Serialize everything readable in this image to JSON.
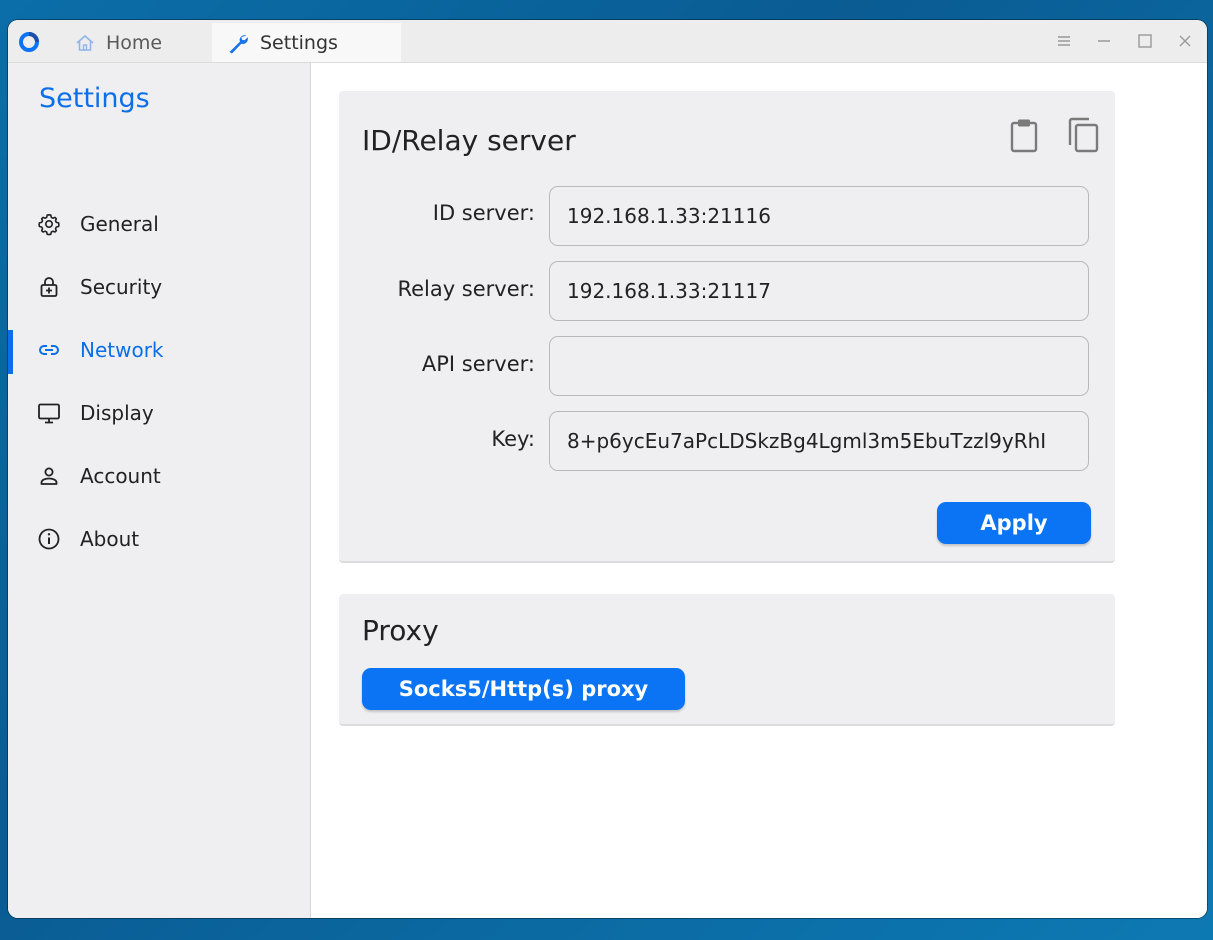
{
  "titlebar": {
    "tabs": [
      {
        "label": "Home",
        "icon": "home-icon"
      },
      {
        "label": "Settings",
        "icon": "wrench-icon"
      }
    ],
    "controls": [
      "menu-icon",
      "minimize-icon",
      "maximize-icon",
      "close-icon"
    ]
  },
  "sidebar": {
    "title": "Settings",
    "items": [
      {
        "label": "General",
        "icon": "gear-icon"
      },
      {
        "label": "Security",
        "icon": "lock-icon"
      },
      {
        "label": "Network",
        "icon": "link-icon",
        "active": true
      },
      {
        "label": "Display",
        "icon": "monitor-icon"
      },
      {
        "label": "Account",
        "icon": "person-icon"
      },
      {
        "label": "About",
        "icon": "info-icon"
      }
    ]
  },
  "id_relay": {
    "title": "ID/Relay server",
    "fields": [
      {
        "label": "ID server:",
        "value": "192.168.1.33:21116"
      },
      {
        "label": "Relay server:",
        "value": "192.168.1.33:21117"
      },
      {
        "label": "API server:",
        "value": ""
      },
      {
        "label": "Key:",
        "value": "8+p6ycEu7aPcLDSkzBg4Lgml3m5EbuTzzl9yRhI"
      }
    ],
    "apply_label": "Apply"
  },
  "proxy": {
    "title": "Proxy",
    "button_label": "Socks5/Http(s) proxy"
  },
  "colors": {
    "accent": "#0a74f5",
    "sidebar_bg": "#efeff1",
    "desktop": "#0b6ea8"
  }
}
